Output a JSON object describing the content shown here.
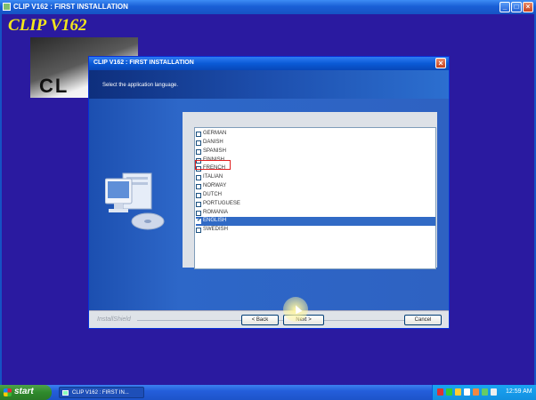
{
  "outer_window": {
    "title": "CLIP V162 : FIRST INSTALLATION",
    "buttons": {
      "minimize": "_",
      "maximize": "□",
      "close": "×"
    }
  },
  "brand": {
    "title": "CLIP V162",
    "logo_text": "CL"
  },
  "dialog": {
    "title": "CLIP V162 : FIRST INSTALLATION",
    "close": "×",
    "prompt": "Select the application language.",
    "languages": [
      {
        "label": "GERMAN",
        "checked": false
      },
      {
        "label": "DANISH",
        "checked": false
      },
      {
        "label": "SPANISH",
        "checked": false
      },
      {
        "label": "FINNISH",
        "checked": false
      },
      {
        "label": "FRENCH",
        "checked": false,
        "highlighted": true
      },
      {
        "label": "ITALIAN",
        "checked": false
      },
      {
        "label": "NORWAY",
        "checked": false
      },
      {
        "label": "DUTCH",
        "checked": false
      },
      {
        "label": "PORTUGUESE",
        "checked": false
      },
      {
        "label": "ROMANIA",
        "checked": false
      },
      {
        "label": "ENGLISH",
        "checked": true,
        "selected": true
      },
      {
        "label": "SWEDISH",
        "checked": false
      }
    ],
    "footer": {
      "brand": "InstallShield",
      "back": "< Back",
      "next": "Next >",
      "cancel": "Cancel"
    }
  },
  "taskbar": {
    "start": "start",
    "task": "CLIP V162 : FIRST IN...",
    "clock": "12:59 AM"
  },
  "colors": {
    "desktop": "#2a1aa0",
    "selection": "#316ac5",
    "highlight_border": "#e02020",
    "brand_text": "#f3e61c"
  }
}
